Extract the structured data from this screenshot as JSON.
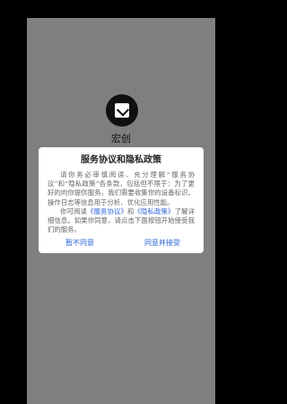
{
  "app": {
    "name": "宏创"
  },
  "dialog": {
    "title": "服务协议和隐私政策",
    "paragraph1": "请你务必审慎阅读、充分理解“服务协议”和“隐私政策”各条款，包括但不限于：为了更好的向你提供服务，我们需要收集你的设备标识、操作日志等信息用于分析、优化应用性能。",
    "p2_prefix": "你可阅读",
    "service_agreement_link": "《服务协议》",
    "p2_and": "和",
    "privacy_policy_link": "《隐私政策》",
    "p2_suffix": "了解详细信息。如果你同意，请点击下面按钮开始接受我们的服务。",
    "disagree_label": "暂不同意",
    "agree_label": "同意并接受"
  },
  "colors": {
    "overlay": "#7f7f7f",
    "link": "#2b63d6"
  },
  "icons": {
    "app_logo": "app-logo-icon"
  }
}
